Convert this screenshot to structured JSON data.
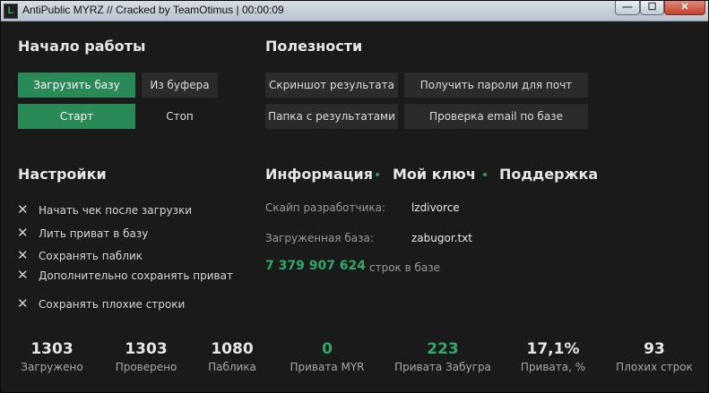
{
  "titlebar": {
    "app_icon_letter": "L",
    "title": "AntiPublic MYRZ // Cracked by TeamOtimus | 00:00:09",
    "minimize": "—",
    "maximize": "☐",
    "close": "✕"
  },
  "start": {
    "heading": "Начало работы",
    "load_base": "Загрузить базу",
    "from_buffer": "Из буфера",
    "start": "Старт",
    "stop": "Стоп"
  },
  "utilities": {
    "heading": "Полезности",
    "screenshot": "Скриншот результата",
    "get_passwords": "Получить пароли для почт",
    "results_folder": "Папка с результатами",
    "check_email": "Проверка email по базе"
  },
  "settings": {
    "heading": "Настройки",
    "options": [
      "Начать чек после загрузки",
      "Лить приват в базу",
      "Сохранять паблик",
      "Дополнительно сохранять приват",
      "Сохранять плохие строки"
    ]
  },
  "info": {
    "tabs": [
      "Информация",
      "Мой ключ",
      "Поддержка"
    ],
    "developer_skype_label": "Скайп разработчика:",
    "developer_skype_value": "lzdivorce",
    "loaded_base_label": "Загруженная база:",
    "loaded_base_value": "zabugor.txt",
    "lines_count": "7 379 907 624",
    "lines_label": "строк в базе"
  },
  "stats": [
    {
      "value": "1303",
      "label": "Загружено"
    },
    {
      "value": "1303",
      "label": "Проверено"
    },
    {
      "value": "1080",
      "label": "Паблика"
    },
    {
      "value": "0",
      "label": "Привата MYR"
    },
    {
      "value": "223",
      "label": "Привата Забугра"
    },
    {
      "value": "17,1%",
      "label": "Привата, %"
    },
    {
      "value": "93",
      "label": "Плохих строк"
    }
  ],
  "colors": {
    "accent_green": "#2a8a57",
    "background": "#1a1a1a",
    "button": "#2b2b2b"
  }
}
